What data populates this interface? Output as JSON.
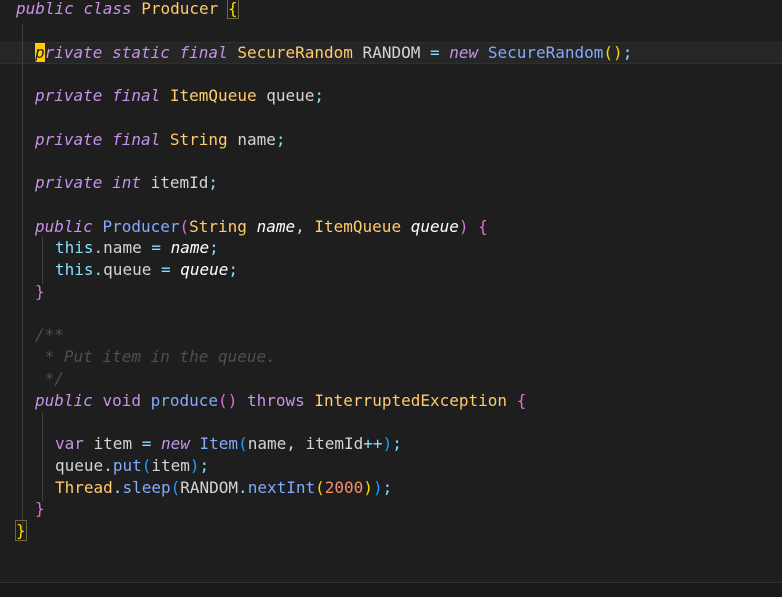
{
  "editor": {
    "language": "java",
    "colors": {
      "background": "#1e1e1e",
      "keyword": "#c792ea",
      "type": "#ffcb6b",
      "function": "#82aaff",
      "punctuation": "#89ddff",
      "number": "#f78c6c",
      "comment": "#4f4f4f",
      "cursor": "#ffcc00"
    },
    "code": {
      "l1": {
        "t1": "public",
        "t2": " ",
        "t3": "class",
        "t4": " ",
        "t5": "Producer",
        "t6": " ",
        "t7": "{"
      },
      "l2": {
        "t1": "p",
        "t2": "rivate",
        "t3": " ",
        "t4": "static",
        "t5": " ",
        "t6": "final",
        "t7": " ",
        "t8": "SecureRandom",
        "t9": " RANDOM ",
        "t10": "=",
        "t11": " ",
        "t12": "new",
        "t13": " ",
        "t14": "SecureRandom",
        "t15": "(",
        "t16": ")",
        "t17": ";"
      },
      "l3": {
        "t1": "private",
        "t2": " ",
        "t3": "final",
        "t4": " ",
        "t5": "ItemQueue",
        "t6": " queue",
        "t7": ";"
      },
      "l4": {
        "t1": "private",
        "t2": " ",
        "t3": "final",
        "t4": " ",
        "t5": "String",
        "t6": " name",
        "t7": ";"
      },
      "l5": {
        "t1": "private",
        "t2": " ",
        "t3": "int",
        "t4": " itemId",
        "t5": ";"
      },
      "l6": {
        "t1": "public",
        "t2": " ",
        "t3": "Producer",
        "t4": "(",
        "t5": "String",
        "t6": " ",
        "t7": "name",
        "t8": ", ",
        "t9": "ItemQueue",
        "t10": " ",
        "t11": "queue",
        "t12": ")",
        "t13": " ",
        "t14": "{"
      },
      "l7": {
        "t1": "this",
        "t2": ".",
        "t3": "name ",
        "t4": "=",
        "t5": " ",
        "t6": "name",
        "t7": ";"
      },
      "l8": {
        "t1": "this",
        "t2": ".",
        "t3": "queue ",
        "t4": "=",
        "t5": " ",
        "t6": "queue",
        "t7": ";"
      },
      "l9": {
        "t1": "}"
      },
      "l10": {
        "t1": "/**"
      },
      "l11": {
        "t1": " * Put item in the queue."
      },
      "l12": {
        "t1": " */"
      },
      "l13": {
        "t1": "public",
        "t2": " ",
        "t3": "void",
        "t4": " ",
        "t5": "produce",
        "t6": "(",
        "t7": ")",
        "t8": " ",
        "t9": "throws",
        "t10": " ",
        "t11": "InterruptedException",
        "t12": " ",
        "t13": "{"
      },
      "l14": {
        "t1": "var",
        "t2": " item ",
        "t3": "=",
        "t4": " ",
        "t5": "new",
        "t6": " ",
        "t7": "Item",
        "t8": "(",
        "t9": "name",
        "t10": ", ",
        "t11": "itemId",
        "t12": "++",
        "t13": ")",
        "t14": ";"
      },
      "l15": {
        "t1": "queue",
        "t2": ".",
        "t3": "put",
        "t4": "(",
        "t5": "item",
        "t6": ")",
        "t7": ";"
      },
      "l16": {
        "t1": "Thread",
        "t2": ".",
        "t3": "sleep",
        "t4": "(",
        "t5": "RANDOM",
        "t6": ".",
        "t7": "nextInt",
        "t8": "(",
        "t9": "2000",
        "t10": ")",
        "t11": ")",
        "t12": ";"
      },
      "l17": {
        "t1": "}"
      },
      "l18": {
        "t1": "}"
      }
    }
  }
}
